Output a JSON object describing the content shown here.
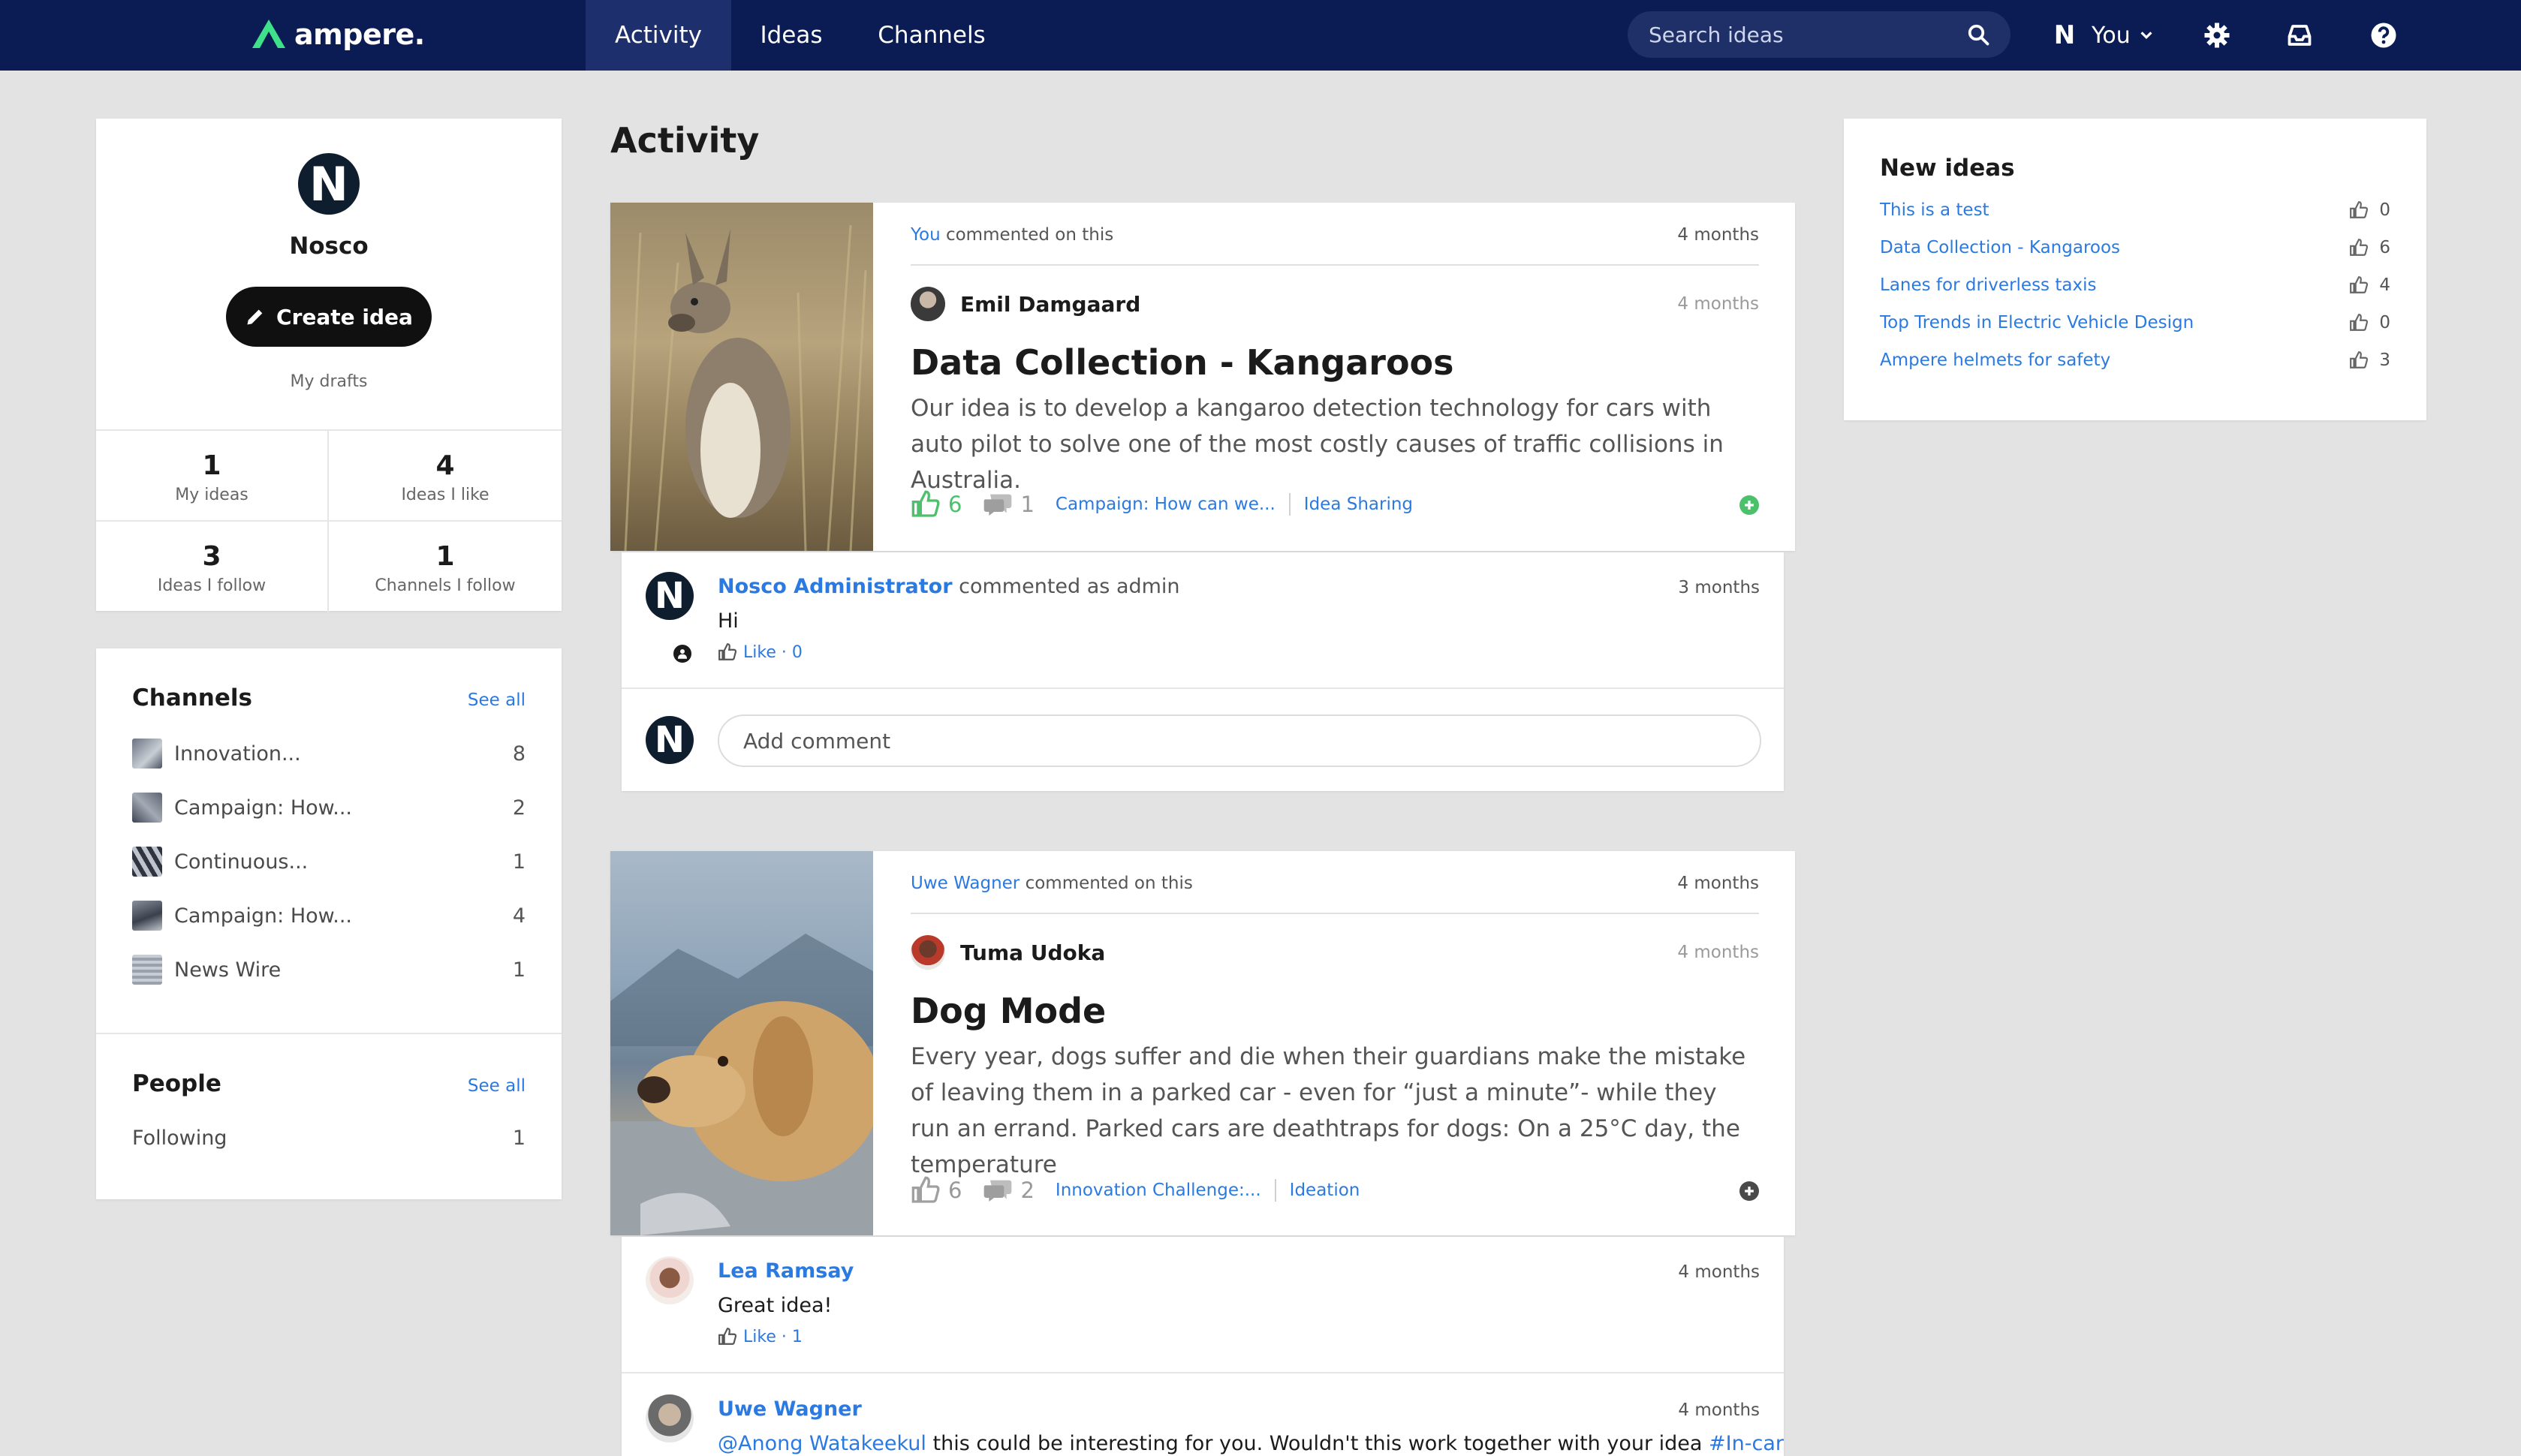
{
  "nav": {
    "brand": "ampere.",
    "tabs": [
      "Activity",
      "Ideas",
      "Channels"
    ],
    "search_placeholder": "Search ideas",
    "user_initial": "N",
    "user_label": "You"
  },
  "profile": {
    "initial": "N",
    "name": "Nosco",
    "create_label": "Create idea",
    "drafts_label": "My drafts",
    "stats": [
      {
        "num": "1",
        "label": "My ideas"
      },
      {
        "num": "4",
        "label": "Ideas I like"
      },
      {
        "num": "3",
        "label": "Ideas I follow"
      },
      {
        "num": "1",
        "label": "Channels I follow"
      }
    ]
  },
  "channels": {
    "title": "Channels",
    "see_all": "See all",
    "items": [
      {
        "name": "Innovation...",
        "count": "8"
      },
      {
        "name": "Campaign: How...",
        "count": "2"
      },
      {
        "name": "Continuous...",
        "count": "1"
      },
      {
        "name": "Campaign: How...",
        "count": "4"
      },
      {
        "name": "News Wire",
        "count": "1"
      }
    ]
  },
  "people": {
    "title": "People",
    "see_all": "See all",
    "items": [
      {
        "name": "Following",
        "count": "1"
      }
    ]
  },
  "main": {
    "title": "Activity",
    "ideas": [
      {
        "actor": "You",
        "action": "commented on this",
        "time": "4 months",
        "author": "Emil Damgaard",
        "author_time": "4 months",
        "title": "Data Collection - Kangaroos",
        "desc": "Our idea is to develop a kangaroo detection technology for cars with auto pilot to solve one of the most costly causes of traffic collisions in Australia.",
        "likes": "6",
        "comments": "1",
        "campaign": "Campaign: How can we...",
        "channel": "Idea Sharing"
      },
      {
        "actor": "Uwe Wagner",
        "action": "commented on this",
        "time": "4 months",
        "author": "Tuma Udoka",
        "author_time": "4 months",
        "title": "Dog Mode",
        "desc": "Every year, dogs suffer and die when their guardians make the mistake of leaving them in a parked car - even for “just a minute”- while they run an errand. Parked cars are deathtraps for dogs: On a 25°C day, the temperature",
        "likes": "6",
        "comments": "2",
        "campaign": "Innovation Challenge:...",
        "channel": "Ideation"
      }
    ],
    "comments1": [
      {
        "author": "Nosco Administrator",
        "rest": "commented as admin",
        "time": "3 months",
        "text": "Hi",
        "like": "Like · 0",
        "initial": "N"
      }
    ],
    "add_comment_placeholder": "Add comment",
    "comments2": [
      {
        "author": "Lea Ramsay",
        "time": "4 months",
        "text": "Great idea!",
        "like": "Like · 1"
      },
      {
        "author": "Uwe Wagner",
        "time": "4 months",
        "mention": "@Anong Watakeekul",
        "text": " this could be interesting for you. Wouldn't this work together with your idea ",
        "hashtag": "#In-car"
      }
    ]
  },
  "new_ideas": {
    "title": "New ideas",
    "items": [
      {
        "name": "This is a test",
        "likes": "0"
      },
      {
        "name": "Data Collection - Kangaroos",
        "likes": "6"
      },
      {
        "name": "Lanes for driverless taxis",
        "likes": "4"
      },
      {
        "name": "Top Trends in Electric Vehicle Design",
        "likes": "0"
      },
      {
        "name": "Ampere helmets for safety",
        "likes": "3"
      }
    ]
  },
  "colors": {
    "nav_bg": "#0b1b54",
    "accent": "#2a7ae2",
    "like_active": "#4cc06b",
    "page_bg": "#e3e3e3"
  }
}
